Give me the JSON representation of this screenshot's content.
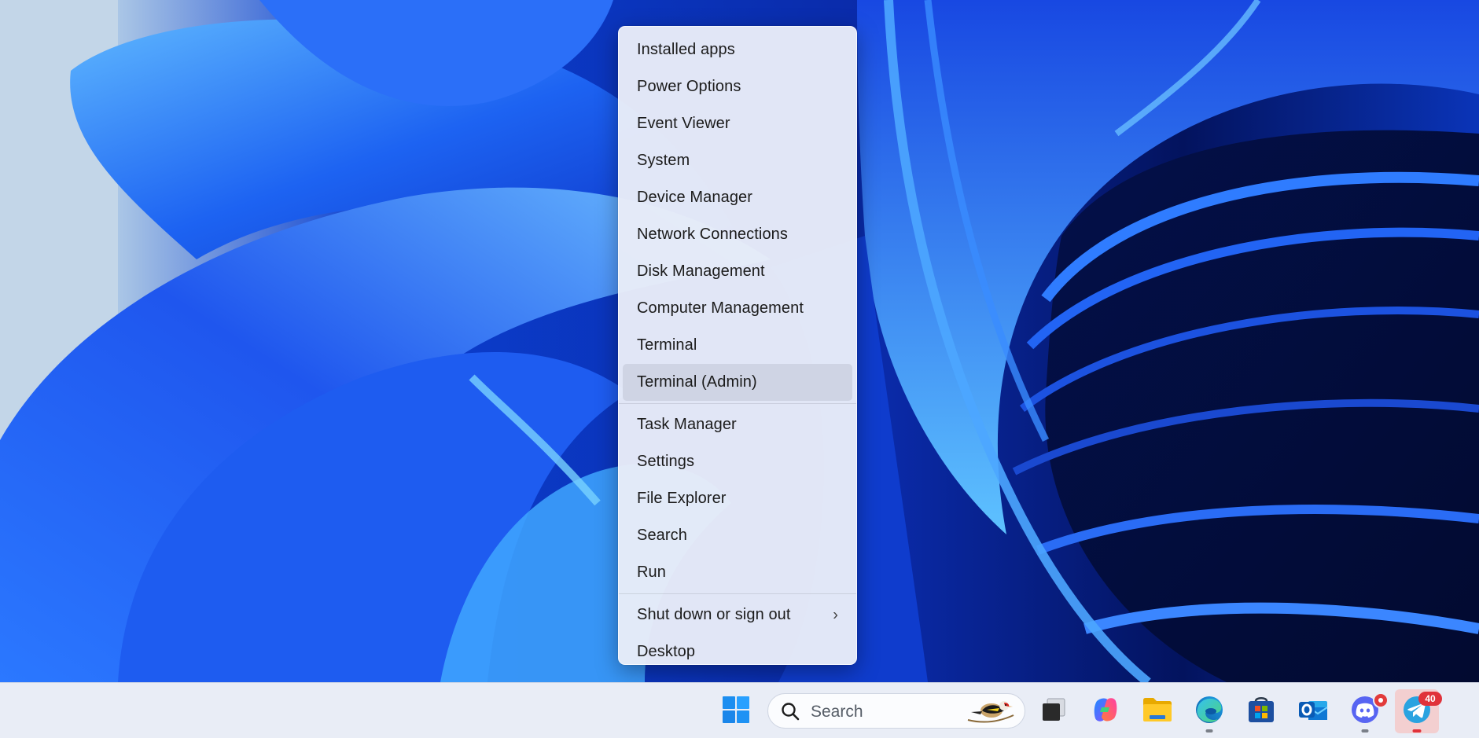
{
  "wallpaper": {
    "name": "Windows 11 Bloom",
    "colors": {
      "sky": "#c7d8ea",
      "deep": "#01147a",
      "accent": "#2f7cff"
    }
  },
  "context_menu": {
    "groups": [
      [
        {
          "label": "Installed apps"
        },
        {
          "label": "Power Options"
        },
        {
          "label": "Event Viewer"
        },
        {
          "label": "System"
        },
        {
          "label": "Device Manager"
        },
        {
          "label": "Network Connections"
        },
        {
          "label": "Disk Management"
        },
        {
          "label": "Computer Management"
        },
        {
          "label": "Terminal"
        },
        {
          "label": "Terminal (Admin)",
          "highlighted": true
        }
      ],
      [
        {
          "label": "Task Manager"
        },
        {
          "label": "Settings"
        },
        {
          "label": "File Explorer"
        },
        {
          "label": "Search"
        },
        {
          "label": "Run"
        }
      ],
      [
        {
          "label": "Shut down or sign out",
          "submenu": true,
          "chevron": "›"
        },
        {
          "label": "Desktop"
        }
      ]
    ]
  },
  "taskbar": {
    "search": {
      "placeholder": "Search",
      "icon": "search-icon",
      "highlight_icon": "goldfinch-bird-icon"
    },
    "icons": [
      {
        "name": "start-button",
        "icon": "windows-logo-icon"
      },
      {
        "name": "task-view-button",
        "icon": "task-view-icon"
      },
      {
        "name": "copilot-button",
        "icon": "copilot-icon"
      },
      {
        "name": "file-explorer-button",
        "icon": "folder-icon"
      },
      {
        "name": "edge-button",
        "icon": "edge-icon",
        "running": true
      },
      {
        "name": "store-button",
        "icon": "store-icon"
      },
      {
        "name": "outlook-button",
        "icon": "outlook-icon"
      },
      {
        "name": "discord-button",
        "icon": "discord-icon",
        "running": true,
        "badge": ""
      },
      {
        "name": "telegram-button",
        "icon": "telegram-icon",
        "running": true,
        "active": true,
        "badge": "40"
      }
    ]
  }
}
